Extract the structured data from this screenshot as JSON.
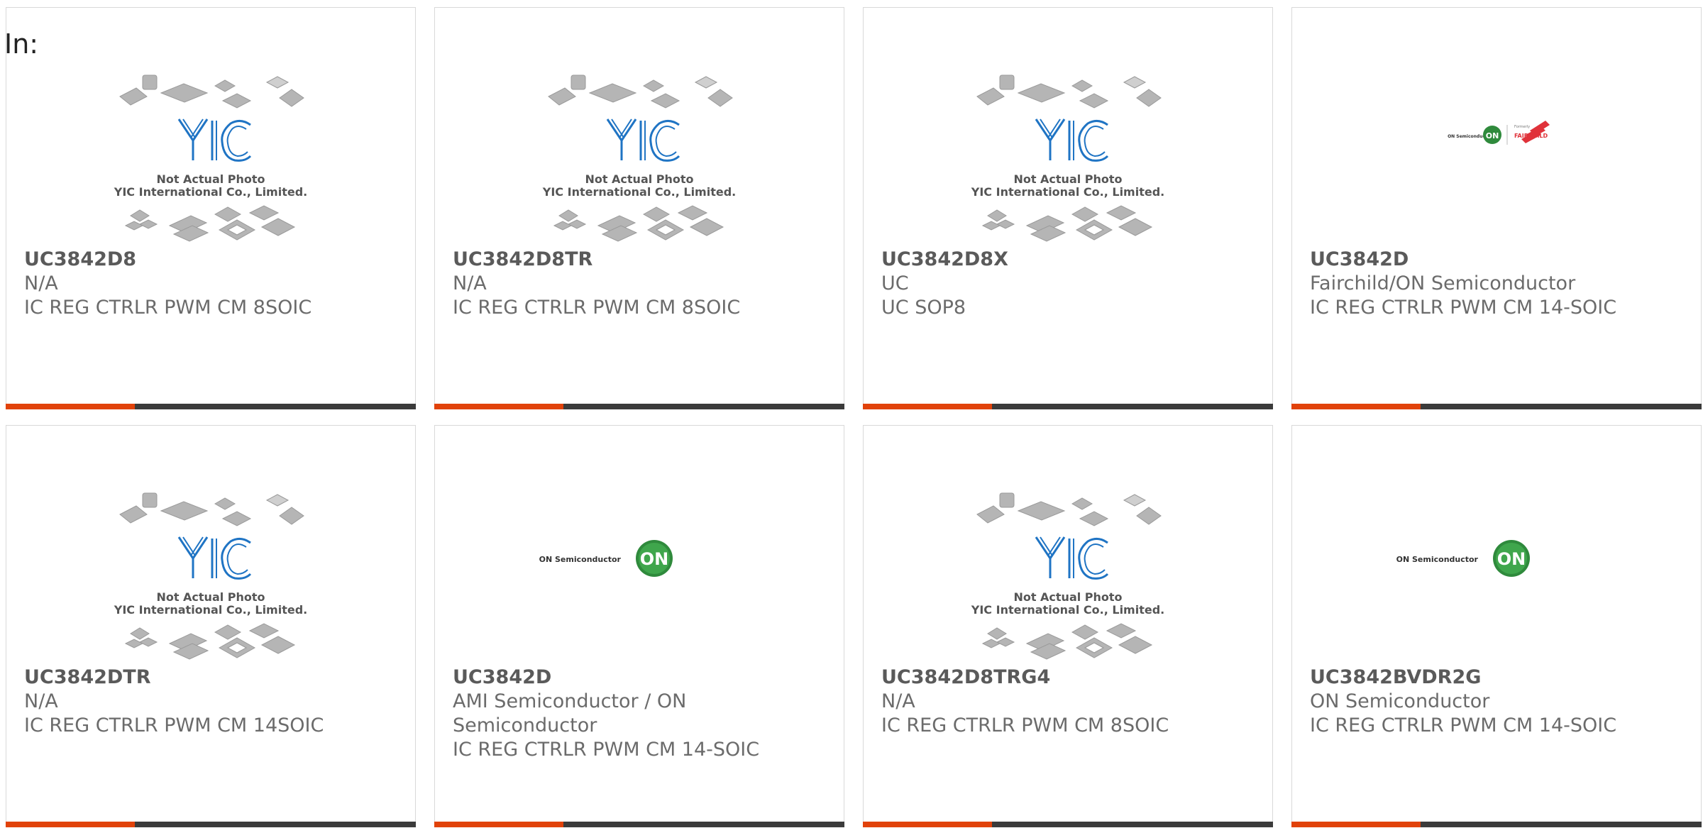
{
  "header": {
    "in_label": "In:"
  },
  "watermark": {
    "logo_text": "YIC",
    "line1": "Not Actual Photo",
    "line2": "YIC International Co., Limited."
  },
  "brand_logos": {
    "on_semi": "ON Semiconductor",
    "on_badge": "ON",
    "formerly": "Formerly",
    "fairchild": "FAIRCHILD"
  },
  "colors": {
    "accent": "#e1420a",
    "bar": "#3b3b3b",
    "text": "#6b6b6b",
    "on_green": "#2f8a3c",
    "yic_blue": "#1f74c4"
  },
  "products": [
    {
      "part": "UC3842D8",
      "manufacturer": "N/A",
      "description": "IC REG CTRLR PWM CM 8SOIC",
      "image": "yic-placeholder"
    },
    {
      "part": "UC3842D8TR",
      "manufacturer": "N/A",
      "description": "IC REG CTRLR PWM CM 8SOIC",
      "image": "yic-placeholder"
    },
    {
      "part": "UC3842D8X",
      "manufacturer": "UC",
      "description": "UC SOP8",
      "image": "yic-placeholder"
    },
    {
      "part": "UC3842D",
      "manufacturer": "Fairchild/ON Semiconductor",
      "description": "IC REG CTRLR PWM CM 14-SOIC",
      "image": "on-fairchild-logo"
    },
    {
      "part": "UC3842DTR",
      "manufacturer": "N/A",
      "description": "IC REG CTRLR PWM CM 14SOIC",
      "image": "yic-placeholder"
    },
    {
      "part": "UC3842D",
      "manufacturer": "AMI Semiconductor / ON Semiconductor",
      "description": "IC REG CTRLR PWM CM 14-SOIC",
      "image": "on-semi-logo"
    },
    {
      "part": "UC3842D8TRG4",
      "manufacturer": "N/A",
      "description": "IC REG CTRLR PWM CM 8SOIC",
      "image": "yic-placeholder"
    },
    {
      "part": "UC3842BVDR2G",
      "manufacturer": "ON Semiconductor",
      "description": "IC REG CTRLR PWM CM 14-SOIC",
      "image": "on-semi-logo"
    }
  ]
}
